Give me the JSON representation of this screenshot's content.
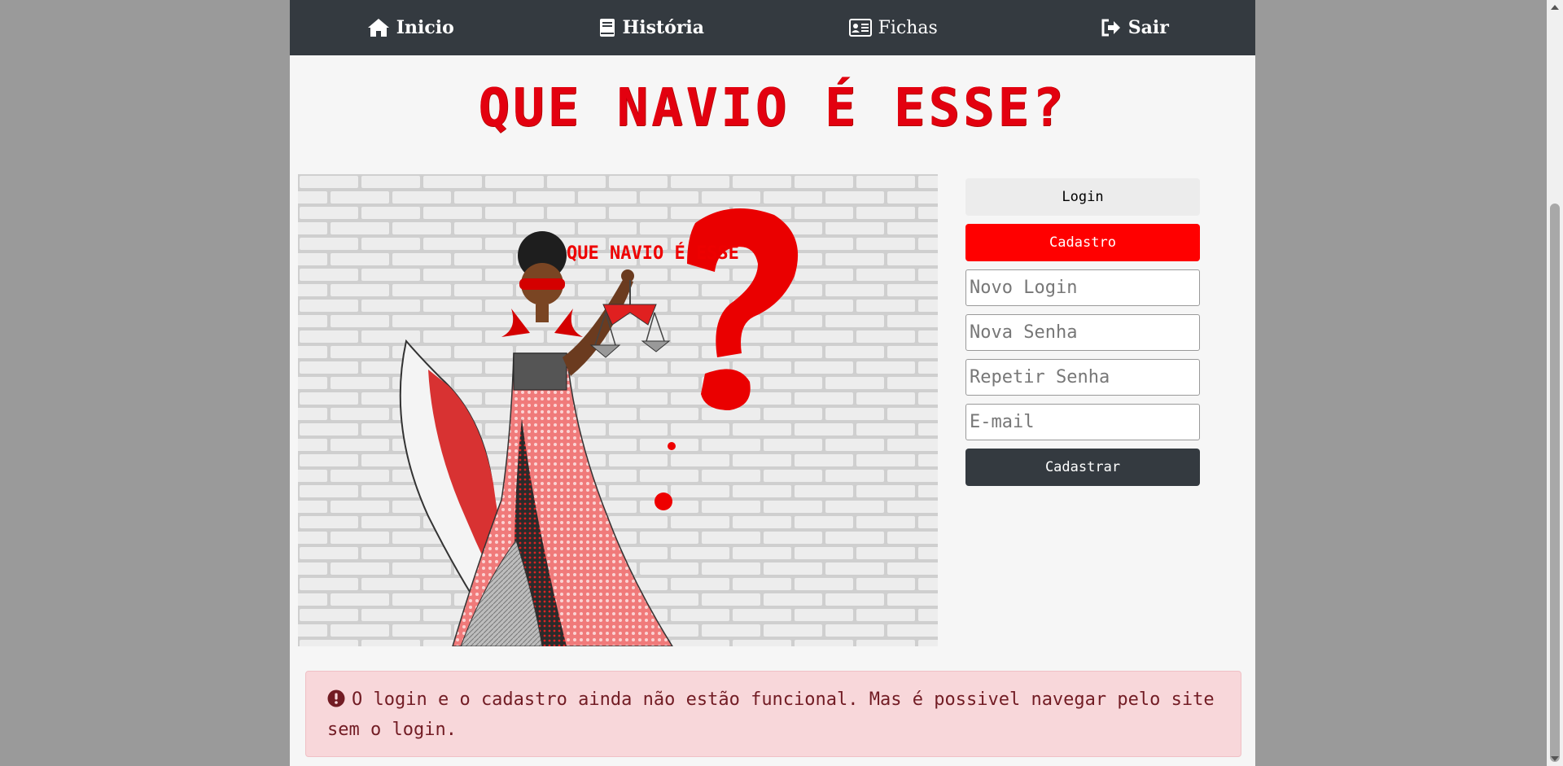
{
  "nav": {
    "items": [
      {
        "label": "Inicio",
        "icon": "home-icon"
      },
      {
        "label": "História",
        "icon": "book-icon"
      },
      {
        "label": "Fichas",
        "icon": "id-card-icon"
      },
      {
        "label": "Sair",
        "icon": "sign-out-icon"
      }
    ]
  },
  "title": "QUE NAVIO É ESSE?",
  "hero": {
    "caption": "QUE NAVIO É ESSE",
    "colors": {
      "accent": "#e3000f",
      "wall": "#e6e6e6"
    }
  },
  "panel": {
    "login_label": "Login",
    "cadastro_label": "Cadastro",
    "fields": {
      "novo_login": "Novo Login",
      "nova_senha": "Nova Senha",
      "repetir_senha": "Repetir Senha",
      "email": "E-mail"
    },
    "submit_label": "Cadastrar"
  },
  "alert": {
    "icon": "exclamation-circle-icon",
    "message": "O login e o cadastro ainda não estão funcional. Mas é possivel navegar pelo site sem o login."
  },
  "colors": {
    "navbar": "#343a40",
    "brand_red": "#ff0000",
    "alert_bg": "#f8d7da",
    "alert_text": "#721c24"
  }
}
